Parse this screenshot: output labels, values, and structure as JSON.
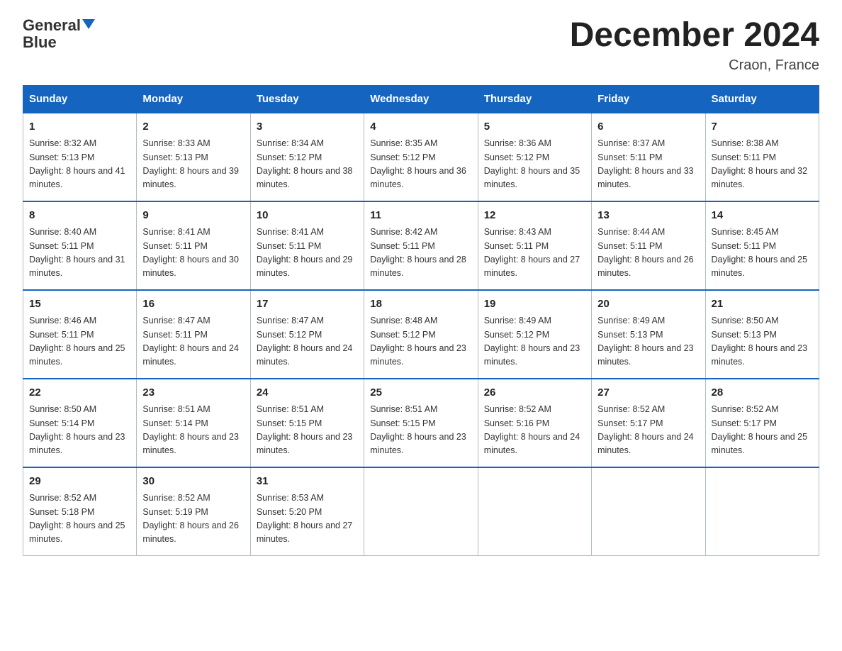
{
  "header": {
    "logo_line1": "General",
    "logo_line2": "Blue",
    "month_title": "December 2024",
    "location": "Craon, France"
  },
  "days_of_week": [
    "Sunday",
    "Monday",
    "Tuesday",
    "Wednesday",
    "Thursday",
    "Friday",
    "Saturday"
  ],
  "weeks": [
    [
      {
        "day": "1",
        "sunrise": "Sunrise: 8:32 AM",
        "sunset": "Sunset: 5:13 PM",
        "daylight": "Daylight: 8 hours and 41 minutes."
      },
      {
        "day": "2",
        "sunrise": "Sunrise: 8:33 AM",
        "sunset": "Sunset: 5:13 PM",
        "daylight": "Daylight: 8 hours and 39 minutes."
      },
      {
        "day": "3",
        "sunrise": "Sunrise: 8:34 AM",
        "sunset": "Sunset: 5:12 PM",
        "daylight": "Daylight: 8 hours and 38 minutes."
      },
      {
        "day": "4",
        "sunrise": "Sunrise: 8:35 AM",
        "sunset": "Sunset: 5:12 PM",
        "daylight": "Daylight: 8 hours and 36 minutes."
      },
      {
        "day": "5",
        "sunrise": "Sunrise: 8:36 AM",
        "sunset": "Sunset: 5:12 PM",
        "daylight": "Daylight: 8 hours and 35 minutes."
      },
      {
        "day": "6",
        "sunrise": "Sunrise: 8:37 AM",
        "sunset": "Sunset: 5:11 PM",
        "daylight": "Daylight: 8 hours and 33 minutes."
      },
      {
        "day": "7",
        "sunrise": "Sunrise: 8:38 AM",
        "sunset": "Sunset: 5:11 PM",
        "daylight": "Daylight: 8 hours and 32 minutes."
      }
    ],
    [
      {
        "day": "8",
        "sunrise": "Sunrise: 8:40 AM",
        "sunset": "Sunset: 5:11 PM",
        "daylight": "Daylight: 8 hours and 31 minutes."
      },
      {
        "day": "9",
        "sunrise": "Sunrise: 8:41 AM",
        "sunset": "Sunset: 5:11 PM",
        "daylight": "Daylight: 8 hours and 30 minutes."
      },
      {
        "day": "10",
        "sunrise": "Sunrise: 8:41 AM",
        "sunset": "Sunset: 5:11 PM",
        "daylight": "Daylight: 8 hours and 29 minutes."
      },
      {
        "day": "11",
        "sunrise": "Sunrise: 8:42 AM",
        "sunset": "Sunset: 5:11 PM",
        "daylight": "Daylight: 8 hours and 28 minutes."
      },
      {
        "day": "12",
        "sunrise": "Sunrise: 8:43 AM",
        "sunset": "Sunset: 5:11 PM",
        "daylight": "Daylight: 8 hours and 27 minutes."
      },
      {
        "day": "13",
        "sunrise": "Sunrise: 8:44 AM",
        "sunset": "Sunset: 5:11 PM",
        "daylight": "Daylight: 8 hours and 26 minutes."
      },
      {
        "day": "14",
        "sunrise": "Sunrise: 8:45 AM",
        "sunset": "Sunset: 5:11 PM",
        "daylight": "Daylight: 8 hours and 25 minutes."
      }
    ],
    [
      {
        "day": "15",
        "sunrise": "Sunrise: 8:46 AM",
        "sunset": "Sunset: 5:11 PM",
        "daylight": "Daylight: 8 hours and 25 minutes."
      },
      {
        "day": "16",
        "sunrise": "Sunrise: 8:47 AM",
        "sunset": "Sunset: 5:11 PM",
        "daylight": "Daylight: 8 hours and 24 minutes."
      },
      {
        "day": "17",
        "sunrise": "Sunrise: 8:47 AM",
        "sunset": "Sunset: 5:12 PM",
        "daylight": "Daylight: 8 hours and 24 minutes."
      },
      {
        "day": "18",
        "sunrise": "Sunrise: 8:48 AM",
        "sunset": "Sunset: 5:12 PM",
        "daylight": "Daylight: 8 hours and 23 minutes."
      },
      {
        "day": "19",
        "sunrise": "Sunrise: 8:49 AM",
        "sunset": "Sunset: 5:12 PM",
        "daylight": "Daylight: 8 hours and 23 minutes."
      },
      {
        "day": "20",
        "sunrise": "Sunrise: 8:49 AM",
        "sunset": "Sunset: 5:13 PM",
        "daylight": "Daylight: 8 hours and 23 minutes."
      },
      {
        "day": "21",
        "sunrise": "Sunrise: 8:50 AM",
        "sunset": "Sunset: 5:13 PM",
        "daylight": "Daylight: 8 hours and 23 minutes."
      }
    ],
    [
      {
        "day": "22",
        "sunrise": "Sunrise: 8:50 AM",
        "sunset": "Sunset: 5:14 PM",
        "daylight": "Daylight: 8 hours and 23 minutes."
      },
      {
        "day": "23",
        "sunrise": "Sunrise: 8:51 AM",
        "sunset": "Sunset: 5:14 PM",
        "daylight": "Daylight: 8 hours and 23 minutes."
      },
      {
        "day": "24",
        "sunrise": "Sunrise: 8:51 AM",
        "sunset": "Sunset: 5:15 PM",
        "daylight": "Daylight: 8 hours and 23 minutes."
      },
      {
        "day": "25",
        "sunrise": "Sunrise: 8:51 AM",
        "sunset": "Sunset: 5:15 PM",
        "daylight": "Daylight: 8 hours and 23 minutes."
      },
      {
        "day": "26",
        "sunrise": "Sunrise: 8:52 AM",
        "sunset": "Sunset: 5:16 PM",
        "daylight": "Daylight: 8 hours and 24 minutes."
      },
      {
        "day": "27",
        "sunrise": "Sunrise: 8:52 AM",
        "sunset": "Sunset: 5:17 PM",
        "daylight": "Daylight: 8 hours and 24 minutes."
      },
      {
        "day": "28",
        "sunrise": "Sunrise: 8:52 AM",
        "sunset": "Sunset: 5:17 PM",
        "daylight": "Daylight: 8 hours and 25 minutes."
      }
    ],
    [
      {
        "day": "29",
        "sunrise": "Sunrise: 8:52 AM",
        "sunset": "Sunset: 5:18 PM",
        "daylight": "Daylight: 8 hours and 25 minutes."
      },
      {
        "day": "30",
        "sunrise": "Sunrise: 8:52 AM",
        "sunset": "Sunset: 5:19 PM",
        "daylight": "Daylight: 8 hours and 26 minutes."
      },
      {
        "day": "31",
        "sunrise": "Sunrise: 8:53 AM",
        "sunset": "Sunset: 5:20 PM",
        "daylight": "Daylight: 8 hours and 27 minutes."
      },
      null,
      null,
      null,
      null
    ]
  ]
}
